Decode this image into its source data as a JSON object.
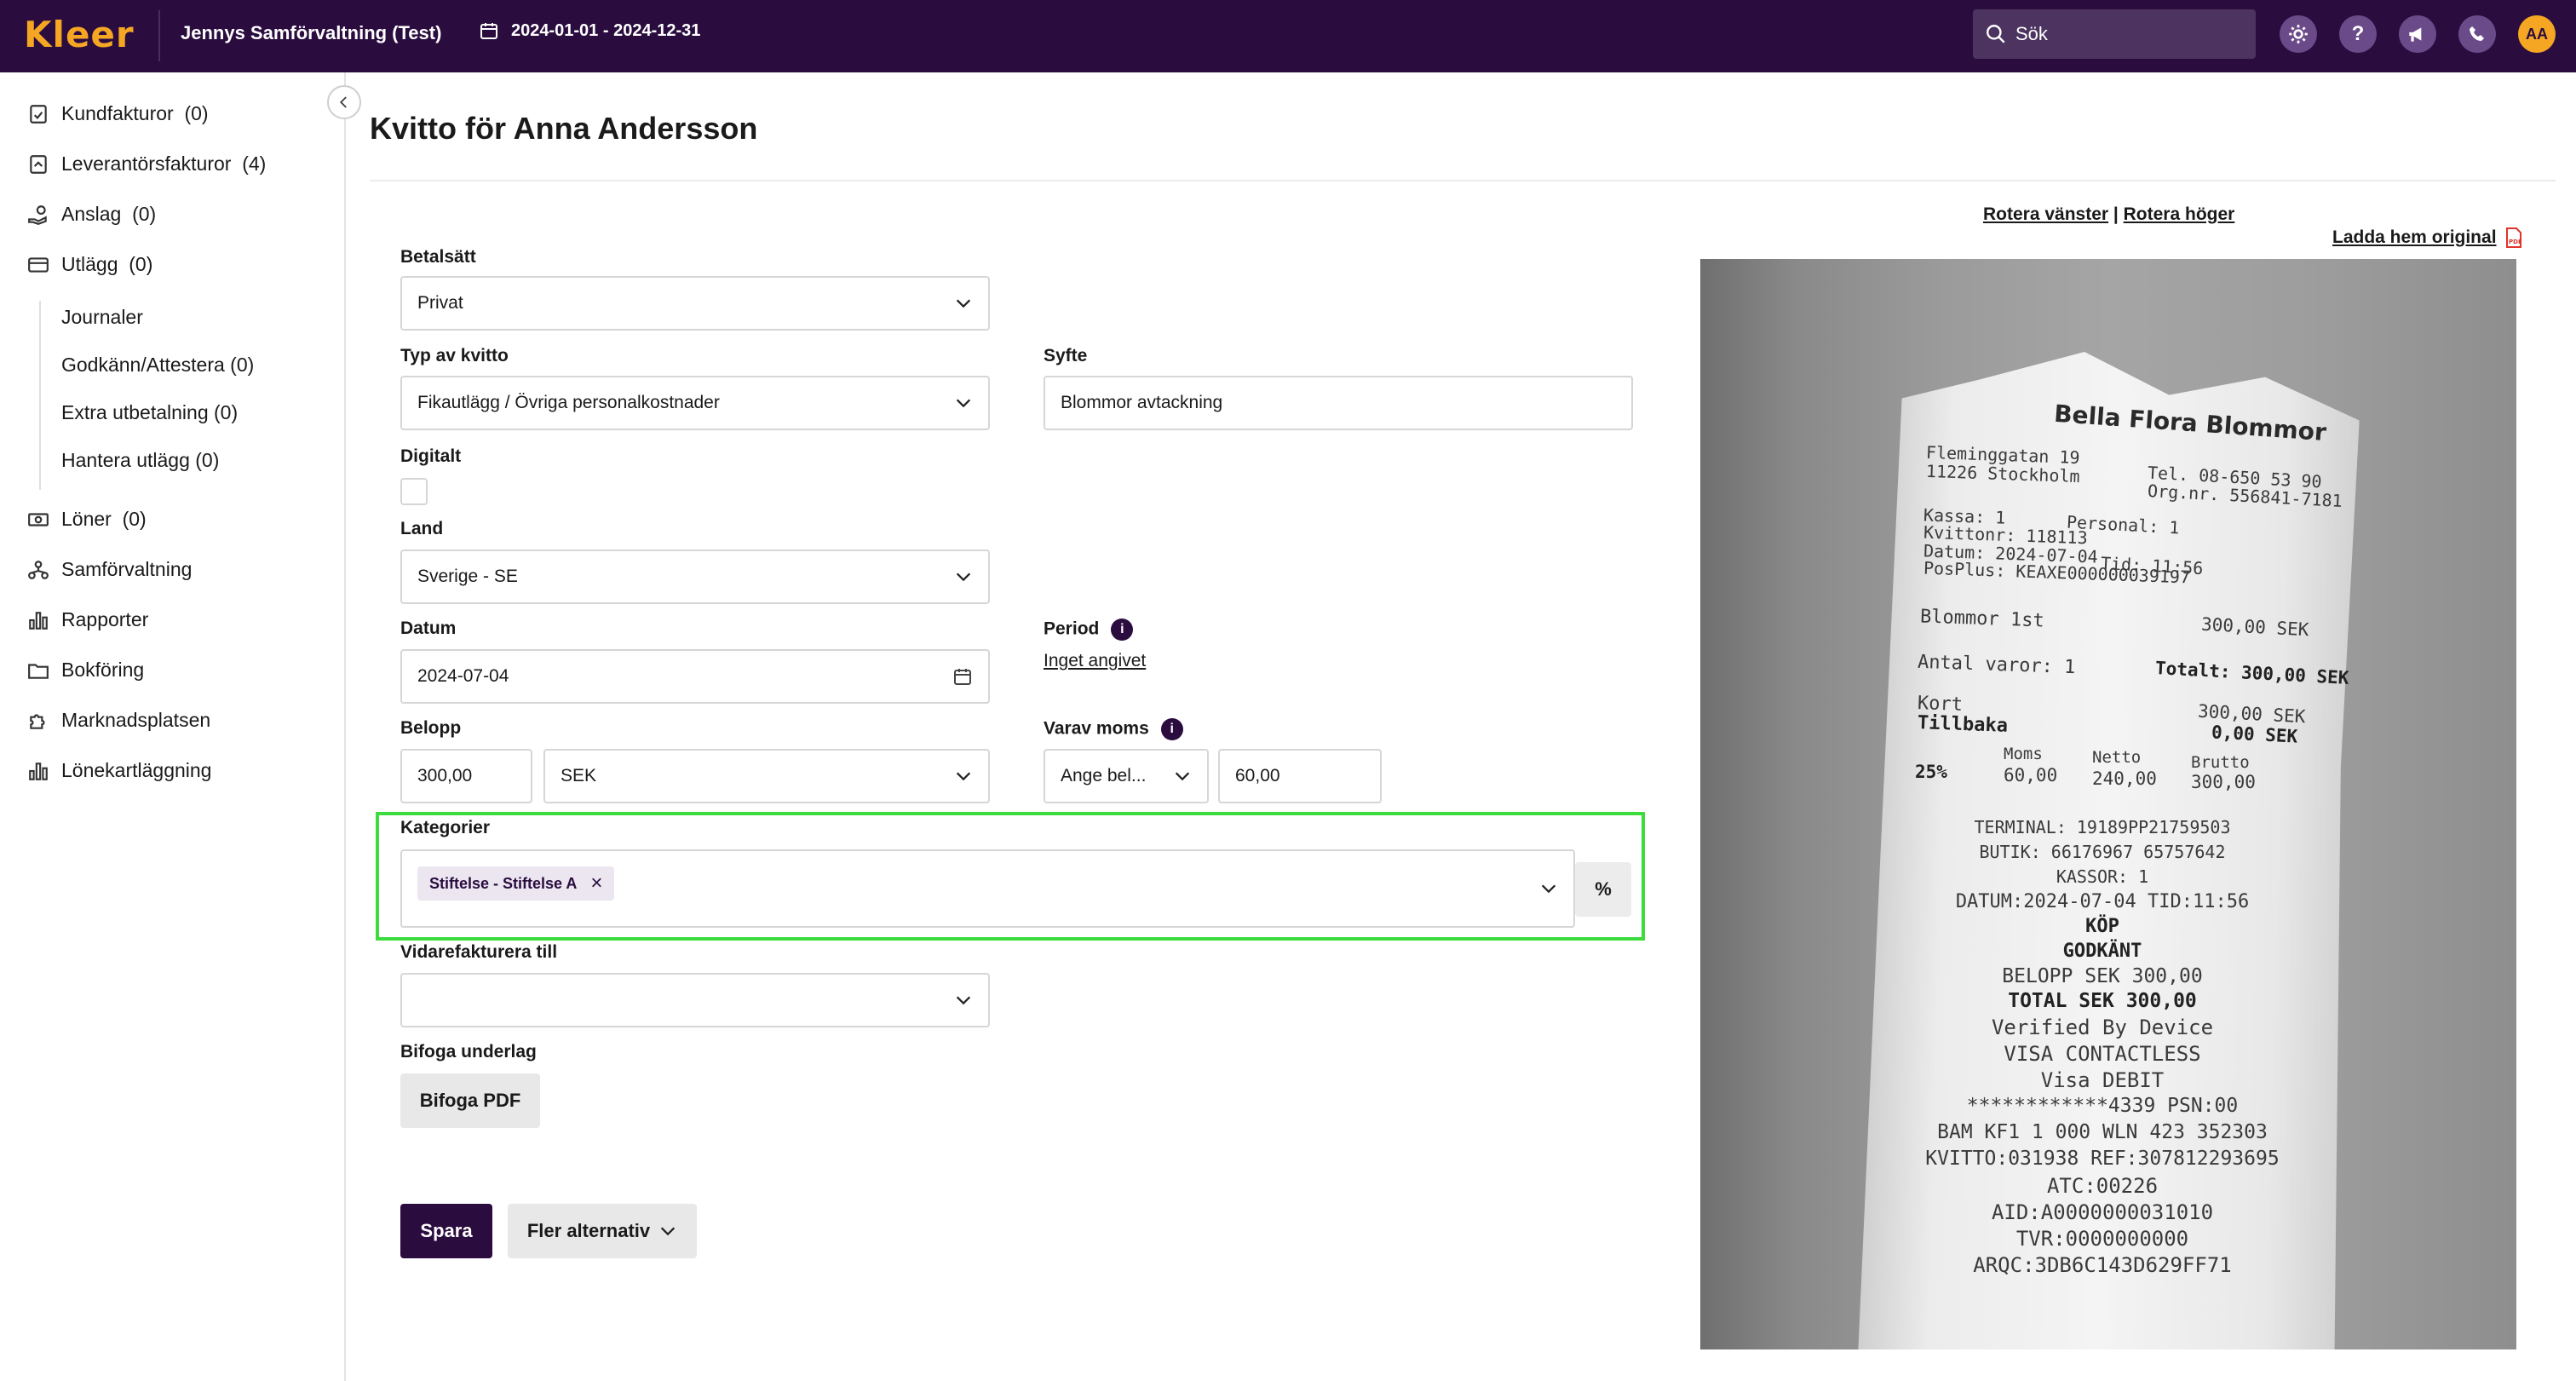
{
  "topbar": {
    "logo": "Kleer",
    "company": "Jennys Samförvaltning (Test)",
    "period": "2024-01-01 - 2024-12-31",
    "search_placeholder": "Sök",
    "avatar": "AA",
    "icons": [
      "gear-icon",
      "help-icon",
      "megaphone-icon",
      "phone-icon"
    ],
    "help_glyph": "?",
    "brand_color": "#2a0c3f",
    "accent_color": "#f5a623"
  },
  "sidebar": {
    "items": [
      {
        "label": "Kundfakturor",
        "count": "(0)"
      },
      {
        "label": "Leverantörsfakturor",
        "count": "(4)"
      },
      {
        "label": "Anslag",
        "count": "(0)"
      },
      {
        "label": "Utlägg",
        "count": "(0)"
      }
    ],
    "subitems": [
      "Journaler",
      "Godkänn/Attestera (0)",
      "Extra utbetalning (0)",
      "Hantera utlägg (0)"
    ],
    "items2": [
      {
        "label": "Löner",
        "count": "(0)"
      },
      {
        "label": "Samförvaltning",
        "count": ""
      },
      {
        "label": "Rapporter",
        "count": ""
      },
      {
        "label": "Bokföring",
        "count": ""
      },
      {
        "label": "Marknadsplatsen",
        "count": ""
      },
      {
        "label": "Lönekartläggning",
        "count": ""
      }
    ]
  },
  "main": {
    "title": "Kvitto för Anna Andersson",
    "betalsatt_label": "Betalsätt",
    "betalsatt_value": "Privat",
    "typ_label": "Typ av kvitto",
    "typ_value": "Fikautlägg / Övriga personalkostnader",
    "syfte_label": "Syfte",
    "syfte_value": "Blommor avtackning",
    "digitalt_label": "Digitalt",
    "land_label": "Land",
    "land_value": "Sverige - SE",
    "datum_label": "Datum",
    "datum_value": "2024-07-04",
    "period_label": "Period",
    "period_value": "Inget angivet",
    "belopp_label": "Belopp",
    "belopp_value": "300,00",
    "currency_value": "SEK",
    "moms_label": "Varav moms",
    "moms_mode": "Ange bel...",
    "moms_value": "60,00",
    "kategorier_label": "Kategorier",
    "kategori_tag": "Stiftelse - Stiftelse A",
    "percent_label": "%",
    "vidare_label": "Vidarefakturera till",
    "bifoga_label": "Bifoga underlag",
    "bifoga_button": "Bifoga PDF",
    "save_button": "Spara",
    "more_button": "Fler alternativ",
    "info_glyph": "i",
    "remove_glyph": "×"
  },
  "receipt_panel": {
    "rotate_left": "Rotera vänster",
    "rotate_sep": "|",
    "rotate_right": "Rotera höger",
    "download": "Ladda hem original"
  },
  "receipt": {
    "store": "Bella Flora Blommor",
    "address1": "Fleminggatan 19",
    "address2": "11226 Stockholm",
    "tel": "Tel. 08-650 53 90",
    "orgnr": "Org.nr. 556841-7181",
    "kassa": "Kassa: 1",
    "personal": "Personal: 1",
    "kvittonr": "Kvittonr: 118113",
    "datum": "Datum: 2024-07-04",
    "tid": "Tid: 11:56",
    "posplus": "PosPlus: KEAXE000000039197",
    "item": "Blommor 1st",
    "item_price": "300,00 SEK",
    "antal": "Antal varor: 1",
    "totalt": "Totalt: 300,00 SEK",
    "kort": "Kort",
    "kort_amount": "300,00 SEK",
    "tillbaka": "Tillbaka",
    "tillbaka_amount": "0,00 SEK",
    "moms_rate": "25%",
    "moms_head": "Moms",
    "moms_val": "60,00",
    "netto_head": "Netto",
    "netto_val": "240,00",
    "brutto_head": "Brutto",
    "brutto_val": "300,00",
    "lines": [
      "TERMINAL: 19189PP21759503",
      "BUTIK: 66176967 65757642",
      "KASSOR: 1",
      "DATUM:2024-07-04 TID:11:56",
      "KÖP",
      "GODKÄNT",
      "BELOPP SEK 300,00",
      "TOTAL SEK 300,00",
      "Verified By Device",
      "VISA CONTACTLESS",
      "Visa DEBIT",
      "************4339 PSN:00",
      "BAM KF1 1 000 WLN 423 352303",
      "KVITTO:031938 REF:307812293695",
      "ATC:00226",
      "AID:A0000000031010",
      "TVR:0000000000",
      "ARQC:3DB6C143D629FF71"
    ]
  }
}
